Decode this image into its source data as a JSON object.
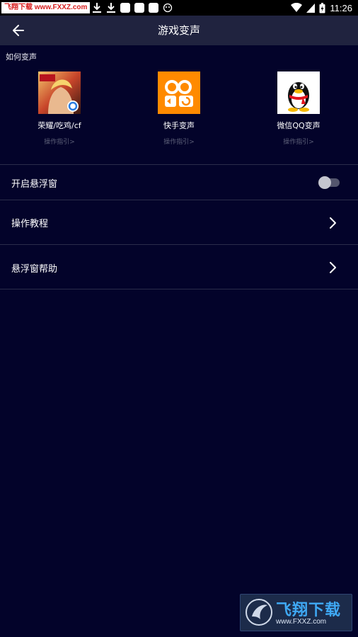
{
  "status_bar": {
    "watermark_text": "飞翔下载 www.FXXZ.com",
    "time": "11:26",
    "icons": [
      "download-icon",
      "download-icon",
      "app-icon",
      "app-icon",
      "app-icon",
      "cat-icon",
      "wifi-icon",
      "signal-icon",
      "battery-icon"
    ]
  },
  "app_bar": {
    "title": "游戏变声",
    "back_icon": "back-arrow-icon"
  },
  "how_to_section": {
    "label": "如何变声",
    "apps": [
      {
        "name": "荣耀/吃鸡/cf",
        "guide": "操作指引>",
        "icon": "game-hero-icon"
      },
      {
        "name": "快手变声",
        "guide": "操作指引>",
        "icon": "kuaishou-icon"
      },
      {
        "name": "微信QQ变声",
        "guide": "操作指引>",
        "icon": "qq-penguin-icon"
      }
    ]
  },
  "settings": [
    {
      "label": "开启悬浮窗",
      "control": "toggle",
      "checked": false
    },
    {
      "label": "操作教程",
      "control": "chevron-right-icon"
    },
    {
      "label": "悬浮窗帮助",
      "control": "chevron-right-icon"
    }
  ],
  "bottom_watermark": {
    "title": "飞翔下载",
    "url": "www.FXXZ.com"
  },
  "colors": {
    "background": "#03032a",
    "app_bar": "#20233f",
    "divider": "#2a2c4a",
    "guide_text": "#5d6078",
    "kuaishou_orange": "#ff8a00"
  }
}
